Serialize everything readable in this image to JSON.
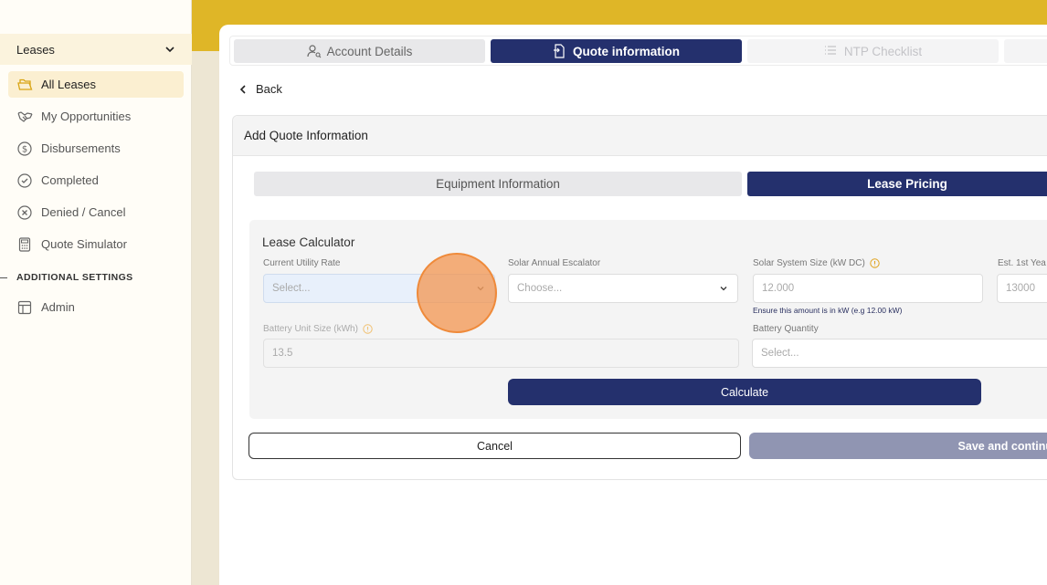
{
  "sidebar": {
    "section_title": "Leases",
    "items": [
      {
        "label": "All Leases",
        "icon": "folder-icon",
        "active": true
      },
      {
        "label": "My Opportunities",
        "icon": "handshake-icon"
      },
      {
        "label": "Disbursements",
        "icon": "dollar-circle-icon"
      },
      {
        "label": "Completed",
        "icon": "check-circle-icon"
      },
      {
        "label": "Denied / Cancel",
        "icon": "x-circle-icon"
      },
      {
        "label": "Quote Simulator",
        "icon": "calculator-icon"
      }
    ],
    "additional_settings_label": "ADDITIONAL SETTINGS",
    "admin_label": "Admin"
  },
  "tabs": [
    {
      "label": "Account Details",
      "state": "inactive"
    },
    {
      "label": "Quote information",
      "state": "active"
    },
    {
      "label": "NTP Checklist",
      "state": "disabled"
    }
  ],
  "back_label": "Back",
  "quote": {
    "title": "Add Quote Information",
    "subtabs": [
      "Equipment Information",
      "Lease Pricing"
    ],
    "calculator": {
      "title": "Lease Calculator",
      "utility_rate": {
        "label": "Current Utility Rate",
        "placeholder": "Select..."
      },
      "escalator": {
        "label": "Solar Annual Escalator",
        "placeholder": "Choose..."
      },
      "system_size": {
        "label": "Solar System Size (kW DC)",
        "value": "12.000",
        "hint": "Ensure this amount is in kW (e.g 12.00 kW)"
      },
      "est_first_year": {
        "label": "Est. 1st Yea",
        "value": "13000"
      },
      "battery_unit_size": {
        "label": "Battery Unit Size (kWh)",
        "value": "13.5"
      },
      "battery_quantity": {
        "label": "Battery Quantity",
        "placeholder": "Select..."
      },
      "calculate_label": "Calculate"
    },
    "cancel_label": "Cancel",
    "save_label": "Save and continue"
  },
  "colors": {
    "navy": "#24306d",
    "gold": "#dfb627",
    "marker": "#f3924a"
  }
}
